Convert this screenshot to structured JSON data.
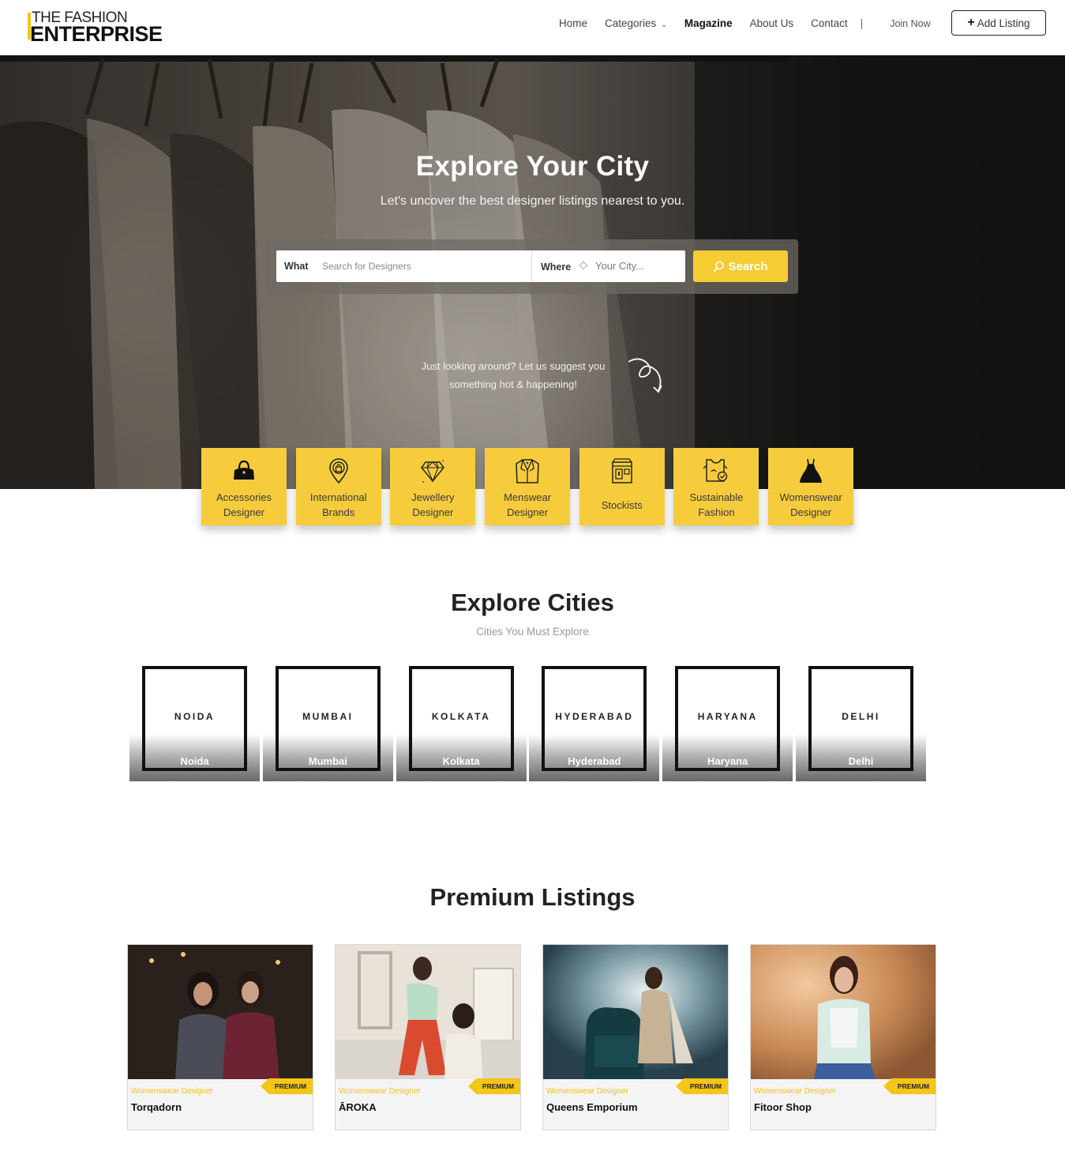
{
  "header": {
    "logo_line1": "THE FASHION",
    "logo_line2": "ENTERPRISE",
    "nav": [
      "Home",
      "Categories",
      "Magazine",
      "About Us",
      "Contact"
    ],
    "separator": "|",
    "join_label": "Join Now",
    "add_listing_label": "Add Listing"
  },
  "hero": {
    "title_part1": "Explore",
    "title_part2": "Your City",
    "subtitle": "Let's uncover the best designer listings nearest to you.",
    "what_label": "What",
    "what_placeholder": "Search for Designers",
    "where_label": "Where",
    "where_placeholder": "Your City...",
    "search_label": "Search",
    "suggest_line1": "Just looking around? Let us suggest you",
    "suggest_line2": "something hot & happening!"
  },
  "categories": [
    {
      "line1": "Accessories",
      "line2": "Designer",
      "icon": "handbag-icon"
    },
    {
      "line1": "International",
      "line2": "Brands",
      "icon": "location-bag-icon"
    },
    {
      "line1": "Jewellery",
      "line2": "Designer",
      "icon": "diamond-icon"
    },
    {
      "line1": "Menswear",
      "line2": "Designer",
      "icon": "suit-icon"
    },
    {
      "line1": "Stockists",
      "line2": "",
      "icon": "store-icon"
    },
    {
      "line1": "Sustainable",
      "line2": "Fashion",
      "icon": "eco-shirt-icon"
    },
    {
      "line1": "Womenswear",
      "line2": "Designer",
      "icon": "dress-icon"
    }
  ],
  "cities_section": {
    "title": "Explore Cities",
    "subtitle": "Cities You Must Explore",
    "cities": [
      {
        "tile": "NOIDA",
        "caption": "Noida"
      },
      {
        "tile": "MUMBAI",
        "caption": "Mumbai"
      },
      {
        "tile": "KOLKATA",
        "caption": "Kolkata"
      },
      {
        "tile": "HYDERABAD",
        "caption": "Hyderabad"
      },
      {
        "tile": "HARYANA",
        "caption": "Haryana"
      },
      {
        "tile": "DELHI",
        "caption": "Delhi"
      }
    ]
  },
  "listings_section": {
    "title": "Premium Listings",
    "badge": "PREMIUM",
    "items": [
      {
        "category": "Womenswear Designer",
        "name": "Torqadorn"
      },
      {
        "category": "Womenswear Designer",
        "name": "ĀROKA"
      },
      {
        "category": "Womenswear Designer",
        "name": "Queens Emporium"
      },
      {
        "category": "Womenswear Designer",
        "name": "Fitoor Shop"
      }
    ]
  },
  "colors": {
    "accent": "#f5cc31",
    "tile_yellow": "#f6cc3d",
    "text_dark": "#222222"
  }
}
